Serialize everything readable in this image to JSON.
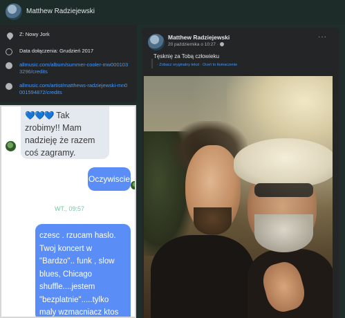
{
  "profile": {
    "name": "Matthew Radziejewski"
  },
  "intro": {
    "items": [
      {
        "icon": "location-pin-icon",
        "text": "Z: Nowy Jork"
      },
      {
        "icon": "clock-icon",
        "text": "Data dołączenia: Grudzień 2017"
      },
      {
        "icon": "globe-icon",
        "text": "allmusic.com/album/summer-cooler-mw0001033296/credits"
      },
      {
        "icon": "globe-icon",
        "text": "allmusic.com/artist/matthews-radziejewski-mn0001594872/credits"
      }
    ]
  },
  "post": {
    "author": "Matthew Radziejewski",
    "timestamp": "20 października o 10:27 ·",
    "text": "Tęsknię za Tobą człowieku",
    "translation": "· Zobacz oryginalny tekst · Oceń to tłumaczenie",
    "more": "···"
  },
  "chat": {
    "incoming_hearts": "💙💙💙",
    "incoming_text": "Tak zrobimy!! Mam nadzieję że razem coś zagramy.",
    "outgoing_short": "Oczywiscie",
    "time_divider": "WT., 09:57",
    "outgoing_long": "czesc . rzucam haslo. Twoj koncert w \"Bardzo\".. funk , slow blues, Chicago shuffle....jestem \"bezplatnie\".....tylko maly wzmacniacz ktos wniesie !"
  },
  "colors": {
    "background": "#1f2e2b",
    "card": "#242526",
    "link": "#4599ff",
    "outgoing_bubble": "#5a8df5",
    "incoming_bubble": "#e3e9ef",
    "time_divider": "#7cc7a0"
  }
}
